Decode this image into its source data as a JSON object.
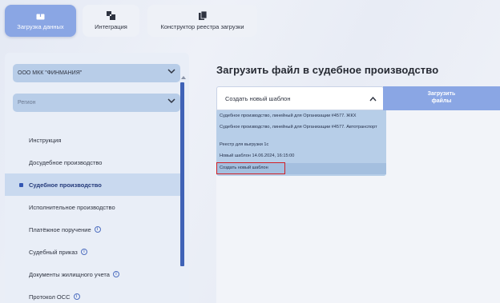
{
  "tabs": [
    {
      "label": "Загрузка данных",
      "icon": "upload-box-icon",
      "active": true
    },
    {
      "label": "Интеграция",
      "icon": "integration-icon",
      "active": false
    },
    {
      "label": "Конструктор реестра загрузки",
      "icon": "documents-icon",
      "active": false
    }
  ],
  "filters": {
    "organization": "ООО МКК \"ФИНМАНИЯ\"",
    "region_placeholder": "Регион"
  },
  "menu": [
    {
      "label": "Инструкция",
      "info": false,
      "active": false
    },
    {
      "label": "Досудебное производство",
      "info": false,
      "active": false
    },
    {
      "label": "Судебное производство",
      "info": false,
      "active": true
    },
    {
      "label": "Исполнительное производство",
      "info": false,
      "active": false
    },
    {
      "label": "Платёжное поручение",
      "info": true,
      "active": false
    },
    {
      "label": "Судебный приказ",
      "info": true,
      "active": false
    },
    {
      "label": "Документы жилищного учета",
      "info": true,
      "active": false
    },
    {
      "label": "Протокол ОСС",
      "info": true,
      "active": false
    }
  ],
  "main": {
    "title": "Загрузить файл в судебное производство",
    "template_selected": "Создать новый шаблон",
    "upload_button": "Загрузить файлы",
    "template_options": [
      "Судебное производство, линейный для Организации #4577. ЖКХ",
      "Судебное производство, линейный для Организации #4577. Автотранспорт",
      "Реестр для выгрузки 1с",
      "Новый шаблон 14.06.2024, 16:15:00",
      "Создать новый шаблон"
    ]
  },
  "colors": {
    "accent": "#8aa6e4",
    "menu_active": "#c9d9ef",
    "select_bg": "#b8cde8",
    "scrollbar": "#3f62b6",
    "highlight_frame": "#d01f26"
  }
}
